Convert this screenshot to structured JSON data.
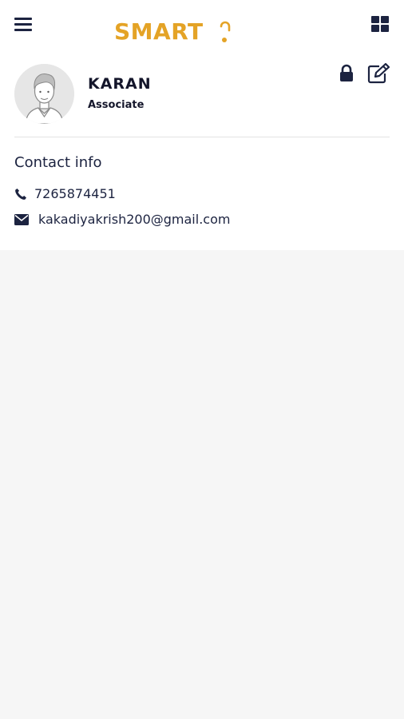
{
  "header": {
    "logo_text": "SMART",
    "menu_icon": "hamburger-menu-icon",
    "apps_icon": "grid-apps-icon",
    "brand_color": "#e4a326"
  },
  "profile": {
    "name": "KARAN",
    "role": "Associate",
    "avatar_icon": "user-avatar-icon",
    "lock_icon": "lock-icon",
    "edit_icon": "edit-icon"
  },
  "contact": {
    "title": "Contact info",
    "phone": "7265874451",
    "email": "kakadiyakrish200@gmail.com",
    "phone_icon": "phone-icon",
    "email_icon": "envelope-icon"
  },
  "colors": {
    "text": "#1c2340",
    "background": "#f6f6f6",
    "card": "#ffffff"
  }
}
